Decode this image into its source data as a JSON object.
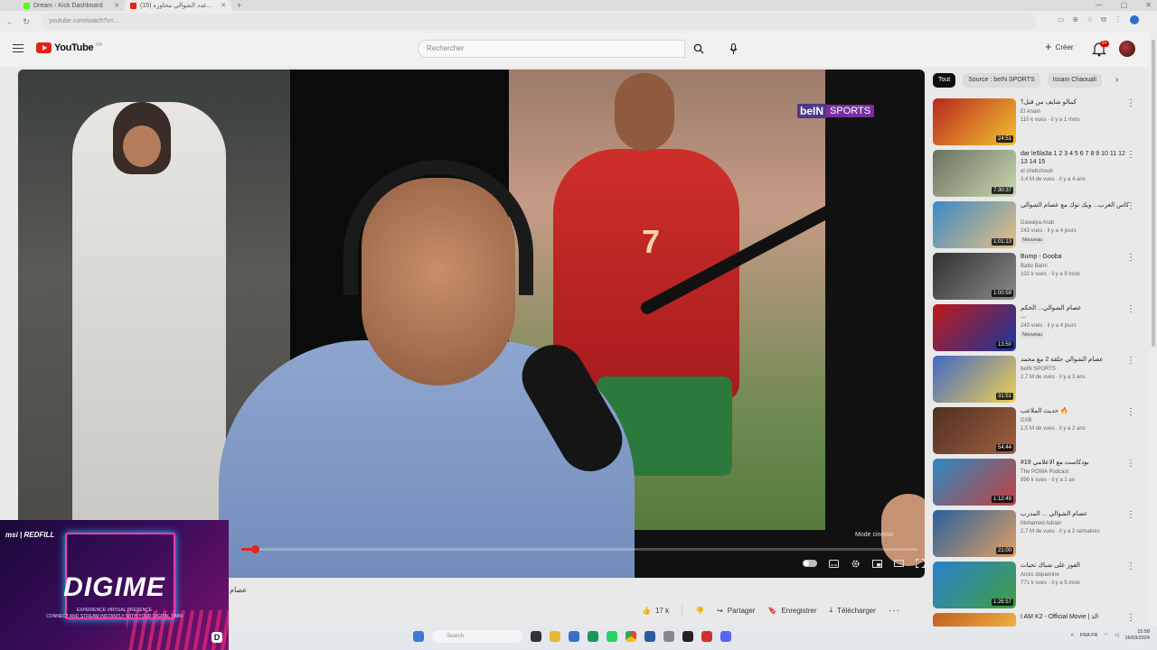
{
  "browser": {
    "tabs": [
      {
        "title": "Dream - Kick Dashboard",
        "icon": "kick-icon",
        "color": "#53fc18"
      },
      {
        "title": "(15) عدد الشوالي محاوره...",
        "icon": "youtube-icon",
        "color": "#e62117"
      }
    ],
    "url": "youtube.com/watch?v=..."
  },
  "header": {
    "logo_text": "YouTube",
    "logo_country": "FR",
    "search_placeholder": "Rechercher",
    "create_label": "Créer",
    "notification_count": "9+"
  },
  "player": {
    "watermark_a": "beIN",
    "watermark_b": "SPORTS",
    "jersey_number": "7",
    "mode_label": "Mode cinéma",
    "progress": 0.02
  },
  "video": {
    "title_partial": "عصام"
  },
  "actions": {
    "likes": "17 k",
    "share": "Partager",
    "save": "Enregistrer",
    "download": "Télécharger"
  },
  "overlay_ad": {
    "brand": "msi | REDFILL",
    "title": "DIGIME",
    "tagline1": "EXPERIENCE VIRTUAL PRESENCE",
    "tagline2": "CONNECT AND STREAM INSTANTLY WITH YOUR DIGITAL TWIN",
    "logo": "D"
  },
  "chips": [
    "Tout",
    "Source : beIN SPORTS",
    "Issam Chaouali"
  ],
  "recommendations": [
    {
      "title": "كمالو شايف من قبل؟",
      "channel": "El Anam",
      "meta": "110 k vues · il y a 1 mois",
      "duration": "24:51",
      "thumb": [
        "#b8281f",
        "#f2c230"
      ]
    },
    {
      "title": "dar le5la3a 1 2 3 4 5 6 7 8 9 10 11 12 13 14 15",
      "channel": "el chebchoub",
      "meta": "3,4 M de vues · il y a 4 ans",
      "duration": "7:30:37",
      "thumb": [
        "#6a7060",
        "#c8d8b0"
      ]
    },
    {
      "title": "كاس العرب... ويك توك مع عصام الشوالي",
      "channel": "Dawaiya Arab",
      "meta": "243 vues · il y a 4 jours",
      "duration": "1:01:13",
      "new": "Nouveau",
      "thumb": [
        "#3a8ac8",
        "#e8c080"
      ]
    },
    {
      "title": "Bump - Gooba",
      "channel": "Batto Bahri",
      "meta": "102 k vues · il y a 9 mois",
      "duration": "1:00:59",
      "thumb": [
        "#303030",
        "#8a8a8a"
      ]
    },
    {
      "title": "عصام الشوالي... الحكم",
      "channel": "—",
      "meta": "243 vues · il y a 4 jours",
      "duration": "13:50",
      "new": "Nouveau",
      "thumb": [
        "#c01818",
        "#1838a0"
      ]
    },
    {
      "title": "عصام الشوالي حلقة 2 مع محمد",
      "channel": "beIN SPORTS",
      "meta": "2,7 M de vues · il y a 3 ans",
      "duration": "31:51",
      "thumb": [
        "#4068c8",
        "#f0d050"
      ]
    },
    {
      "title": "حديث الملاعب 🔥",
      "channel": "GXB",
      "meta": "1,5 M de vues · il y a 2 ans",
      "duration": "54:44",
      "thumb": [
        "#503020",
        "#a06040"
      ]
    },
    {
      "title": "#19 بودكاست مع الاعلامي",
      "channel": "The POWA Podcast",
      "meta": "899 k vues · il y a 1 an",
      "duration": "1:12:49",
      "thumb": [
        "#2f8ac0",
        "#c04040"
      ]
    },
    {
      "title": "عصام الشوالي ... المدرب",
      "channel": "Mohamed Adrian",
      "meta": "2,7 M de vues · il y a 2 semaines",
      "duration": "21:00",
      "thumb": [
        "#2860a0",
        "#e0a060"
      ]
    },
    {
      "title": "الفوز على شباك تحيات",
      "channel": "Aniss dopamine",
      "meta": "771 k vues · il y a 5 mois",
      "duration": "1:26:57",
      "thumb": [
        "#2a80d0",
        "#40a040"
      ]
    },
    {
      "title": "I AM K2 - Official Movie | الذ",
      "channel": "",
      "meta": "",
      "duration": "",
      "thumb": [
        "#c06020",
        "#f0b040"
      ]
    }
  ],
  "taskbar": {
    "search": "Search",
    "lang": "FRA FR",
    "time": "15:58",
    "date": "16/03/2024"
  },
  "colors": {
    "youtube_red": "#e62117",
    "bein_purple": "#7a2fa0",
    "overlay_pink": "#ff3ab0"
  }
}
